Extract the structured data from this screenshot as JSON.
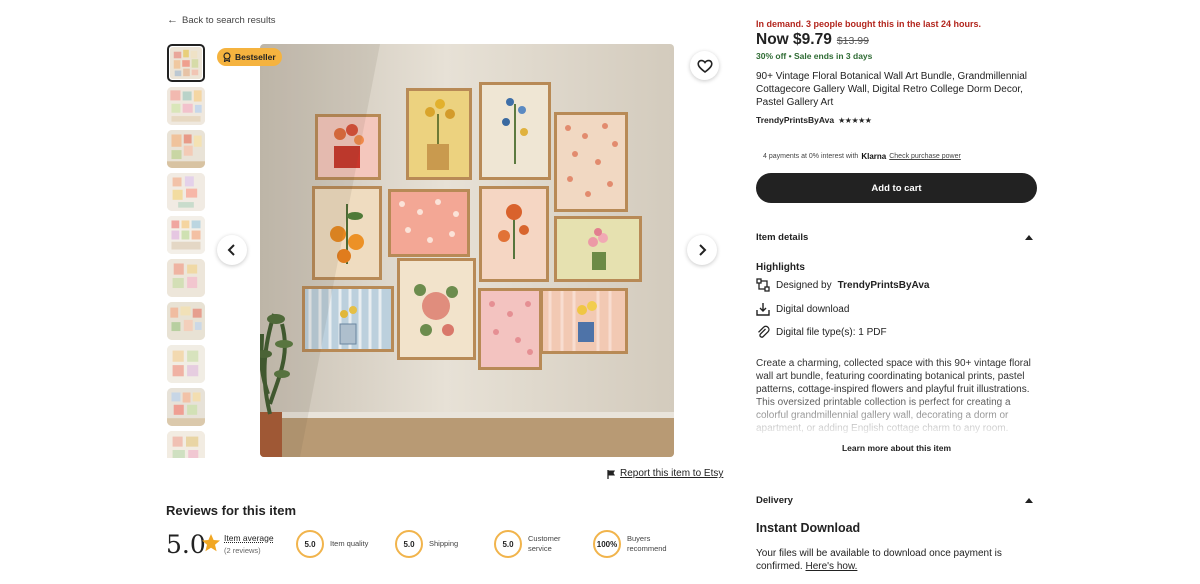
{
  "nav": {
    "back_label": "Back to search results"
  },
  "gallery": {
    "badge": "Bestseller",
    "thumbnail_count": 10,
    "report_label": "Report this item to Etsy"
  },
  "reviews": {
    "title": "Reviews for this item",
    "score": "5.0",
    "avg_label": "Item average",
    "avg_sub": "(2 reviews)",
    "metrics": [
      {
        "value": "5.0",
        "label": "Item quality"
      },
      {
        "value": "5.0",
        "label": "Shipping"
      },
      {
        "value": "5.0",
        "label": "Customer service"
      },
      {
        "value": "100%",
        "label": "Buyers recommend"
      }
    ]
  },
  "product": {
    "demand": "In demand. 3 people bought this in the last 24 hours.",
    "price_now": "Now $9.79",
    "price_old": "$13.99",
    "discount": "30% off",
    "sale_ends": "Sale ends in 3 days",
    "title": "90+ Vintage Floral Botanical Wall Art Bundle, Grandmillennial Cottagecore Gallery Wall, Digital Retro College Dorm Decor, Pastel Gallery Art",
    "seller": "TrendyPrintsByAva",
    "rating_stars": 4.5,
    "klarna_text": "4 payments at 0% interest with",
    "klarna_brand": "Klarna",
    "klarna_link": "Check purchase power",
    "cart_label": "Add to cart"
  },
  "details": {
    "header": "Item details",
    "highlights_label": "Highlights",
    "designed_prefix": "Designed by",
    "designed_by": "TrendyPrintsByAva",
    "digital_download": "Digital download",
    "file_types": "Digital file type(s): 1 PDF",
    "description": "Create a charming, collected space with this 90+ vintage floral wall art bundle, featuring coordinating botanical prints, pastel patterns, cottage-inspired flowers and playful fruit illustrations. This oversized printable collection is perfect for creating a colorful grandmillennial gallery wall, decorating a dorm or apartment, or adding English cottage charm to any room.",
    "learn_more": "Learn more about this item"
  },
  "delivery": {
    "header": "Delivery",
    "instant": "Instant Download",
    "files_text": "Your files will be available to download once payment is confirmed.",
    "heres_how": "Here's how."
  },
  "colors": {
    "badge": "#f5b33f",
    "demand_red": "#b3261e",
    "sale_green": "#2f6b34",
    "cart_button": "#222222",
    "metric_ring": "#f1b44c"
  }
}
